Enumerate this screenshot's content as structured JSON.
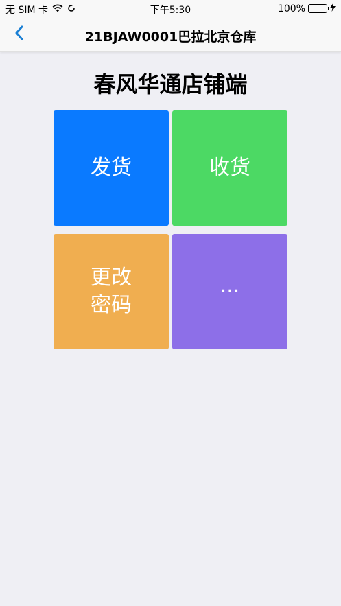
{
  "status_bar": {
    "carrier": "无 SIM 卡",
    "wifi_icon": "wifi-icon",
    "sync_icon": "sync-icon",
    "time": "下午5:30",
    "battery_percent": "100%",
    "battery_level": 1.0,
    "battery_color": "#4CD964"
  },
  "nav": {
    "back_icon": "chevron-left-icon",
    "title": "21BJAW0001巴拉北京仓库",
    "accent": "#1A7FD4"
  },
  "page": {
    "title": "春风华通店铺端"
  },
  "tiles": [
    {
      "label": "发货",
      "color": "#0A7AFF"
    },
    {
      "label": "收货",
      "color": "#4CD964"
    },
    {
      "label": "更改\n密码",
      "color": "#F0AE50"
    },
    {
      "label": "···",
      "color": "#8D6FE8"
    }
  ]
}
